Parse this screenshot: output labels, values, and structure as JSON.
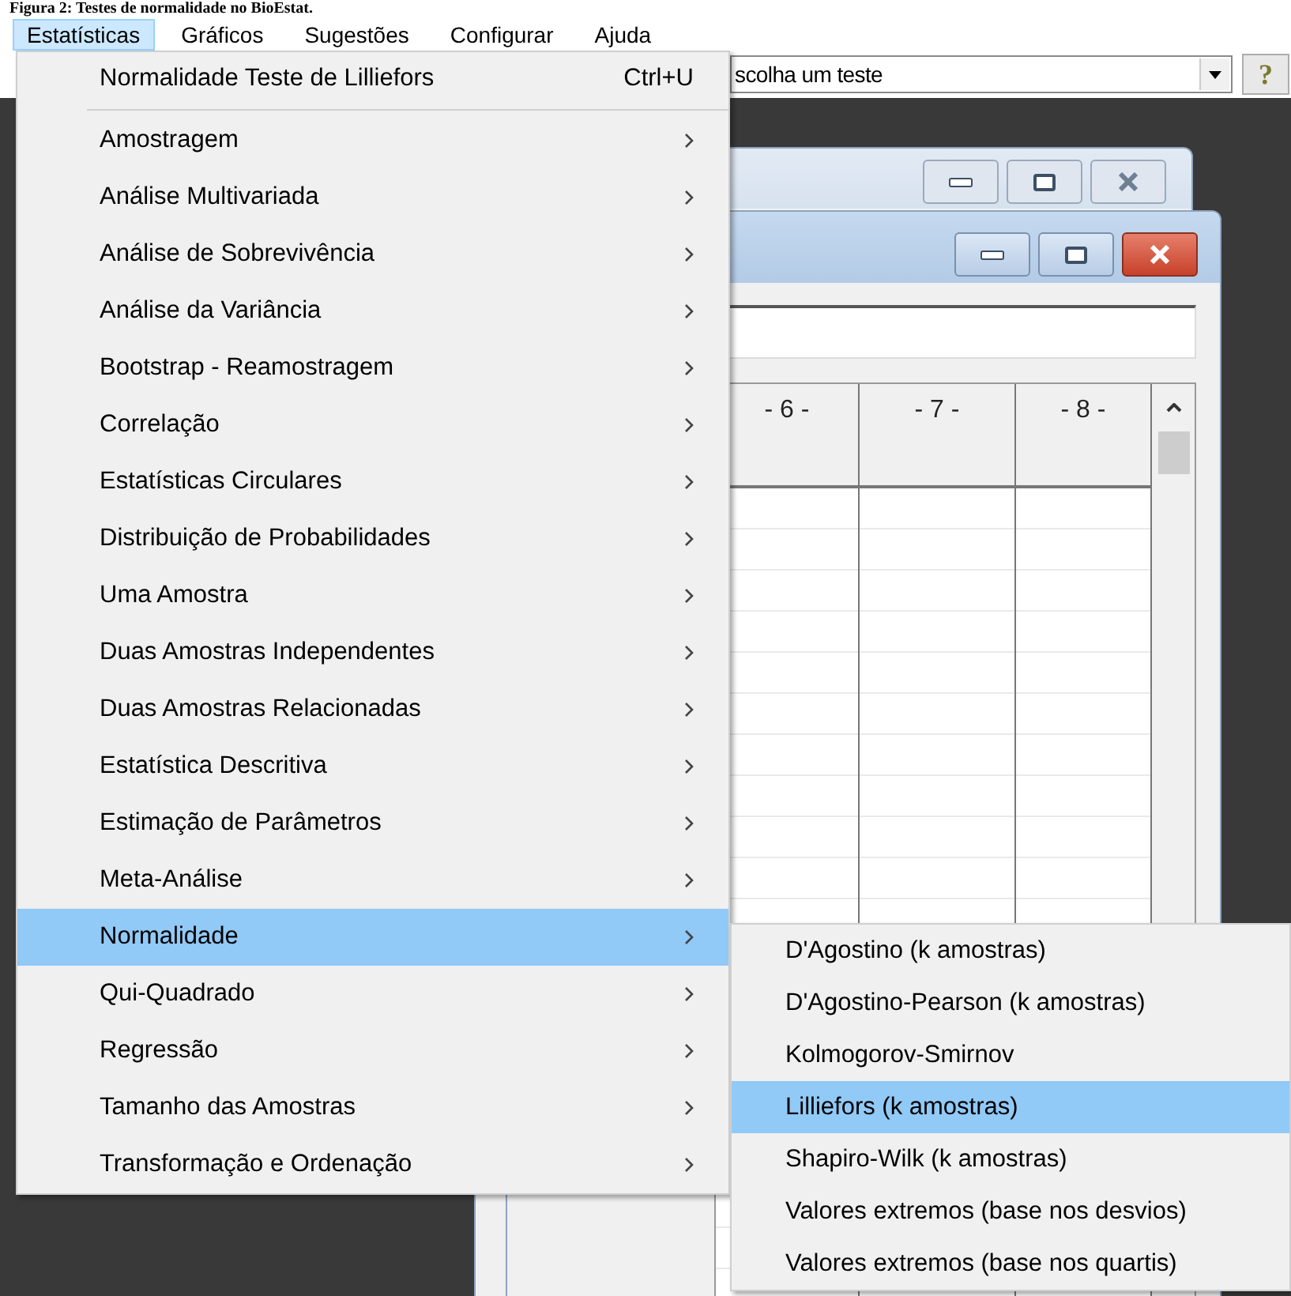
{
  "caption": "Figura 2: Testes de normalidade no BioEstat.",
  "menubar": [
    {
      "label": "Estatísticas",
      "selected": true
    },
    {
      "label": "Gráficos",
      "selected": false
    },
    {
      "label": "Sugestões",
      "selected": false
    },
    {
      "label": "Configurar",
      "selected": false
    },
    {
      "label": "Ajuda",
      "selected": false
    }
  ],
  "toolbar": {
    "test_select": {
      "value": "scolha um teste"
    },
    "help_button": {
      "label": "?"
    }
  },
  "windows": [
    {
      "active": false
    },
    {
      "active": true,
      "grid": {
        "columns": [
          "- 6 -",
          "- 7 -",
          "- 8 -"
        ]
      }
    }
  ],
  "menu": {
    "items": [
      {
        "kind": "command",
        "label": "Normalidade Teste de Lilliefors",
        "shortcut": "Ctrl+U",
        "selected": false
      },
      {
        "kind": "separator"
      },
      {
        "kind": "submenu",
        "label": "Amostragem",
        "selected": false
      },
      {
        "kind": "submenu",
        "label": "Análise Multivariada",
        "selected": false
      },
      {
        "kind": "submenu",
        "label": "Análise de Sobrevivência",
        "selected": false
      },
      {
        "kind": "submenu",
        "label": "Análise da Variância",
        "selected": false
      },
      {
        "kind": "submenu",
        "label": "Bootstrap - Reamostragem",
        "selected": false
      },
      {
        "kind": "submenu",
        "label": "Correlação",
        "selected": false
      },
      {
        "kind": "submenu",
        "label": "Estatísticas Circulares",
        "selected": false
      },
      {
        "kind": "submenu",
        "label": "Distribuição de Probabilidades",
        "selected": false
      },
      {
        "kind": "submenu",
        "label": "Uma Amostra",
        "selected": false
      },
      {
        "kind": "submenu",
        "label": "Duas Amostras Independentes",
        "selected": false
      },
      {
        "kind": "submenu",
        "label": "Duas Amostras Relacionadas",
        "selected": false
      },
      {
        "kind": "submenu",
        "label": "Estatística Descritiva",
        "selected": false
      },
      {
        "kind": "submenu",
        "label": "Estimação de Parâmetros",
        "selected": false
      },
      {
        "kind": "submenu",
        "label": "Meta-Análise",
        "selected": false
      },
      {
        "kind": "submenu",
        "label": "Normalidade",
        "selected": true
      },
      {
        "kind": "submenu",
        "label": "Qui-Quadrado",
        "selected": false
      },
      {
        "kind": "submenu",
        "label": "Regressão",
        "selected": false
      },
      {
        "kind": "submenu",
        "label": "Tamanho das Amostras",
        "selected": false
      },
      {
        "kind": "submenu",
        "label": "Transformação e Ordenação",
        "selected": false
      }
    ]
  },
  "submenu": {
    "items": [
      {
        "kind": "entry",
        "label": "D'Agostino (k amostras)",
        "selected": false
      },
      {
        "kind": "entry",
        "label": "D'Agostino-Pearson (k amostras)",
        "selected": false
      },
      {
        "kind": "entry",
        "label": "Kolmogorov-Smirnov",
        "selected": false
      },
      {
        "kind": "entry",
        "label": "Lilliefors (k amostras)",
        "selected": true
      },
      {
        "kind": "entry",
        "label": "Shapiro-Wilk (k amostras)",
        "selected": false
      },
      {
        "kind": "entry",
        "label": "Valores extremos (base nos desvios)",
        "selected": false
      },
      {
        "kind": "entry",
        "label": "Valores extremos (base nos quartis)",
        "selected": false
      }
    ]
  }
}
